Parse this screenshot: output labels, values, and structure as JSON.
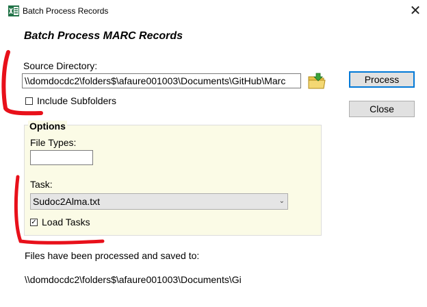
{
  "window": {
    "title": "Batch Process Records",
    "close_glyph": "✕",
    "app_icon": "excel-like-green-icon"
  },
  "heading": "Batch Process MARC Records",
  "source": {
    "label": "Source Directory:",
    "path_value": "\\\\domdocdc2\\folders$\\afaure001003\\Documents\\GitHub\\Marc",
    "folder_icon": "folder-open-icon",
    "include_subfolders_label": "Include Subfolders",
    "include_subfolders_checked": false
  },
  "buttons": {
    "process": "Process",
    "close": "Close"
  },
  "options": {
    "legend": "Options",
    "file_types_label": "File Types:",
    "file_types_value": "",
    "task_label": "Task:",
    "task_selected": "Sudoc2Alma.txt",
    "load_tasks_label": "Load Tasks",
    "load_tasks_checked": true,
    "check_glyph": "✓",
    "chevron_glyph": "⌄"
  },
  "status": {
    "message": "Files have been processed and saved to:",
    "path": "\\\\domdocdc2\\folders$\\afaure001003\\Documents\\Gi"
  },
  "colors": {
    "options_bg": "#fbfbe6",
    "accent_border": "#0078d7",
    "annotation_red": "#e8101a"
  }
}
